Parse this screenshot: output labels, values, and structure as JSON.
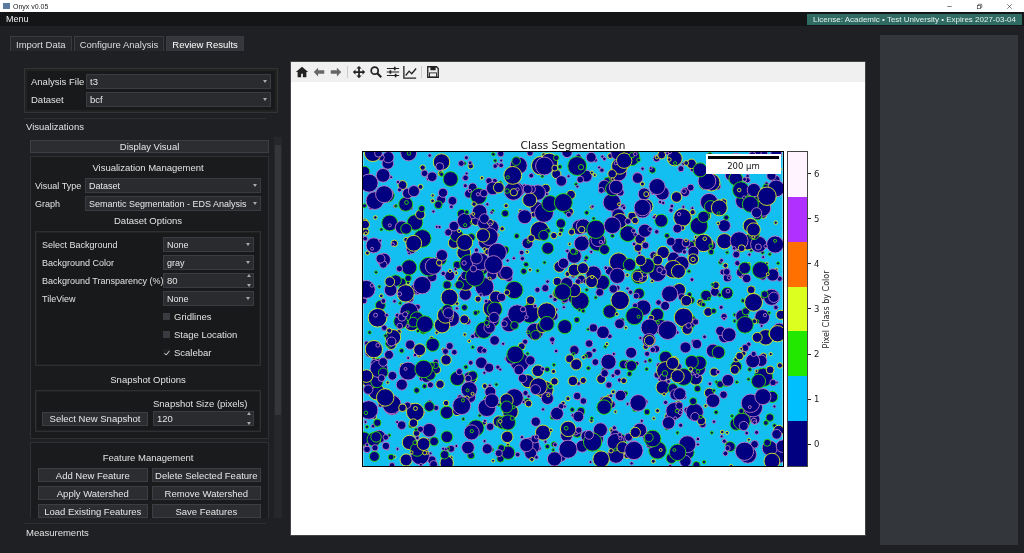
{
  "window": {
    "title": "Onyx v0.05"
  },
  "menu": [
    "Menu"
  ],
  "license": "License: Academic • Test University • Expires 2027-03-04",
  "tabs": [
    {
      "label": "Import Data",
      "selected": false
    },
    {
      "label": "Configure Analysis",
      "selected": false
    },
    {
      "label": "Review Results",
      "selected": true
    }
  ],
  "analysis": [
    {
      "label": "Analysis File",
      "value": "t3"
    },
    {
      "label": "Dataset",
      "value": "bcf"
    }
  ],
  "visualizations": {
    "title": "Visualizations",
    "display_button": "Display Visual",
    "management": {
      "title": "Visualization Management",
      "fields": [
        {
          "label": "Visual Type",
          "value": "Dataset"
        },
        {
          "label": "Graph",
          "value": "Semantic Segmentation - EDS Analysis"
        }
      ]
    },
    "dataset_options": {
      "title": "Dataset Options",
      "rows": [
        {
          "kind": "dropdown",
          "label": "Select Background",
          "value": "None"
        },
        {
          "kind": "dropdown",
          "label": "Background Color",
          "value": "gray"
        },
        {
          "kind": "spin",
          "label": "Background Transparency (%)",
          "value": "80"
        },
        {
          "kind": "dropdown",
          "label": "TileView",
          "value": "None"
        },
        {
          "kind": "checkbox",
          "label": "Gridlines",
          "checked": false
        },
        {
          "kind": "checkbox",
          "label": "Stage Location",
          "checked": false
        },
        {
          "kind": "checkbox",
          "label": "Scalebar",
          "checked": true
        }
      ]
    },
    "snapshot_options": {
      "title": "Snapshot Options",
      "size_label": "Snapshot Size (pixels)",
      "button": "Select New Snapshot",
      "size_value": "120"
    },
    "feature_management": {
      "title": "Feature Management",
      "buttons": [
        "Add New Feature",
        "Delete Selected Feature",
        "Apply Watershed",
        "Remove Watershed",
        "Load Existing Features",
        "Save Features"
      ]
    }
  },
  "measurements": {
    "title": "Measurements"
  },
  "plot": {
    "title": "Class Segmentation",
    "scalebar_label": "200 µm",
    "colorbar": {
      "label": "Pixel Class by Color",
      "classes": [
        {
          "label": "6",
          "color": "#fff4ff"
        },
        {
          "label": "5",
          "color": "#b030ff"
        },
        {
          "label": "4",
          "color": "#ff7000"
        },
        {
          "label": "3",
          "color": "#ddff20"
        },
        {
          "label": "2",
          "color": "#22e800"
        },
        {
          "label": "1",
          "color": "#00bfff"
        },
        {
          "label": "0",
          "color": "#000080"
        }
      ]
    }
  }
}
